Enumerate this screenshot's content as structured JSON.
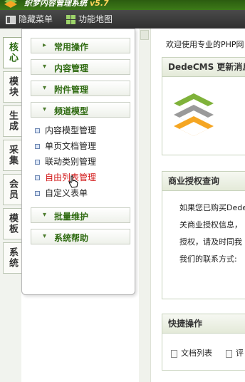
{
  "app": {
    "title": "织梦内容管理系统",
    "version": "v5.7"
  },
  "topbar": {
    "hide_menu": "隐藏菜单",
    "function_map": "功能地图"
  },
  "lefttabs": [
    "核心",
    "模块",
    "生成",
    "采集",
    "会员",
    "模板",
    "系统"
  ],
  "panel": {
    "categories": {
      "common": "常用操作",
      "content": "内容管理",
      "attachment": "附件管理",
      "channel_model": "频道模型",
      "batch": "批量维护",
      "help": "系统帮助"
    },
    "channel_items": [
      "内容模型管理",
      "单页文档管理",
      "联动类别管理",
      "自由列表管理",
      "自定义表单"
    ]
  },
  "main": {
    "welcome": "欢迎使用专业的PHP网",
    "news_title": "DedeCMS 更新消息",
    "license_title": "商业授权查询",
    "license_lines": [
      "如果您已购买Dede",
      "关商业授权信息，",
      "授权，请及时同我",
      "我们的联系方式:"
    ],
    "quick_title": "快捷操作",
    "quick_items": [
      "文档列表",
      "评"
    ]
  },
  "colors": {
    "brand_green": "#2e6a10",
    "highlight_red": "#d21818",
    "topbar_dark": "#3a3a3a"
  }
}
